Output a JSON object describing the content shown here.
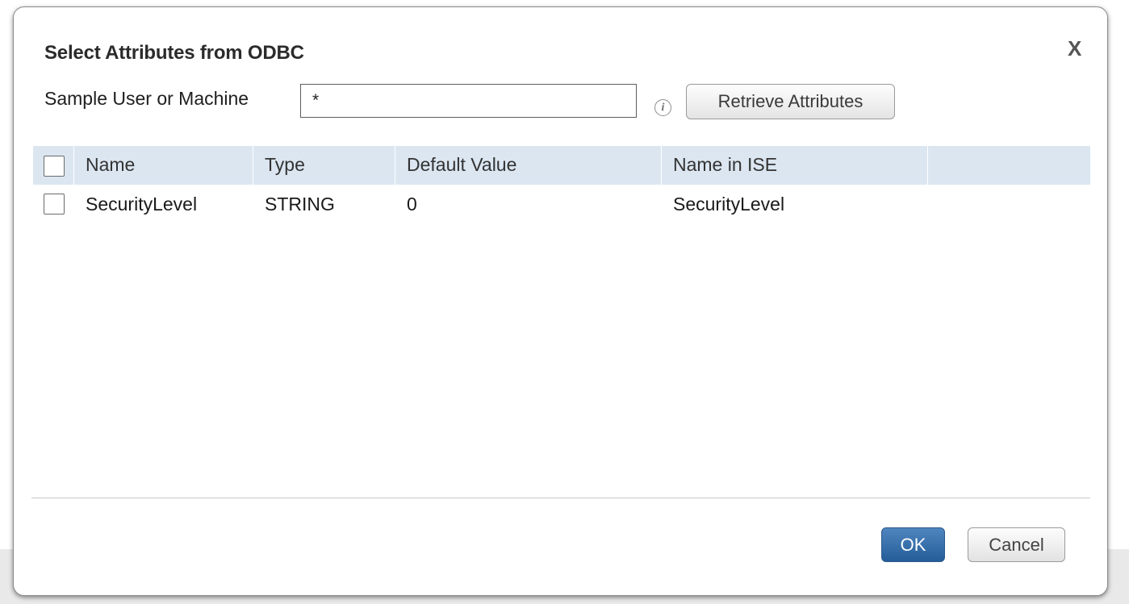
{
  "dialog": {
    "title": "Select Attributes from ODBC",
    "close_label": "X"
  },
  "sample": {
    "label": "Sample User or Machine",
    "value": "*",
    "info_icon": "info-icon",
    "retrieve_label": "Retrieve Attributes"
  },
  "table": {
    "columns": [
      "Name",
      "Type",
      "Default Value",
      "Name in ISE"
    ],
    "rows": [
      {
        "name": "SecurityLevel",
        "type": "STRING",
        "default_value": "0",
        "name_in_ise": "SecurityLevel",
        "checked": false
      }
    ]
  },
  "footer": {
    "ok_label": "OK",
    "cancel_label": "Cancel"
  },
  "colors": {
    "header_bg": "#dbe6f1",
    "primary_button": "#245d99"
  }
}
